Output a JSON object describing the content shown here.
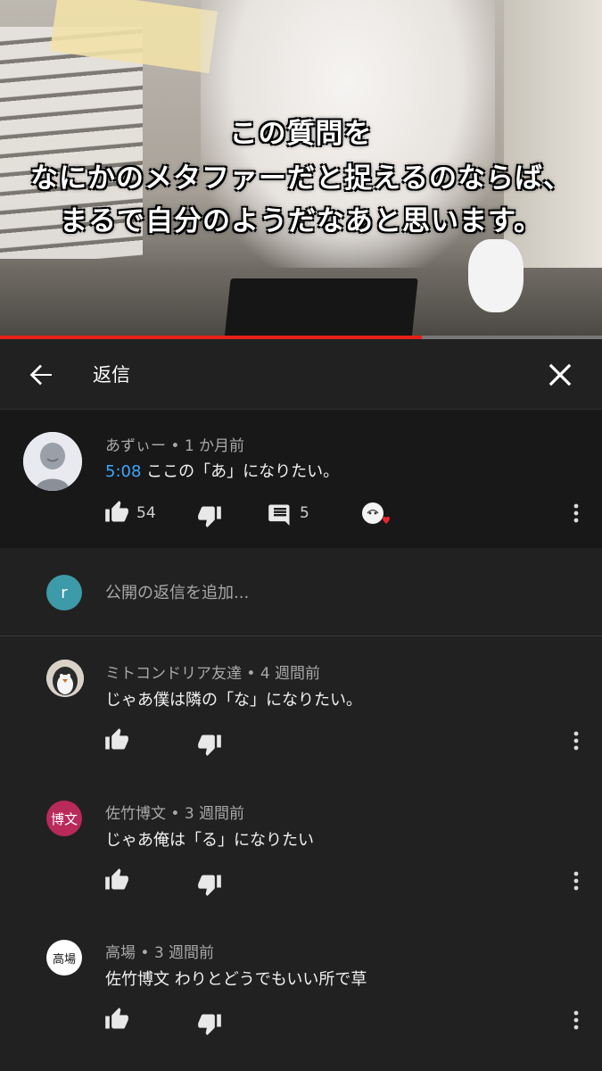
{
  "video": {
    "subtitle_lines": [
      "この質問を",
      "なにかのメタファーだと捉えるのならば、",
      "まるで自分のようだなあと思います。"
    ],
    "progress": 0.7
  },
  "header": {
    "title": "返信",
    "back_icon": "arrow-left-icon",
    "close_icon": "close-icon"
  },
  "parent_comment": {
    "author_meta": "あずぃー • 1 か月前",
    "timestamp": "5:08",
    "text": "ここの「あ」になりたい。",
    "likes": "54",
    "replies": "5"
  },
  "add_reply": {
    "avatar_letter": "r",
    "placeholder": "公開の返信を追加..."
  },
  "replies": [
    {
      "author_meta": "ミトコンドリア友達 • 4 週間前",
      "text": "じゃあ僕は隣の「な」になりたい。"
    },
    {
      "avatar_text": "博文",
      "author_meta": "佐竹博文 • 3 週間前",
      "text": "じゃあ俺は「る」になりたい"
    },
    {
      "avatar_text": "高場",
      "author_meta": "高場 • 3 週間前",
      "text": "佐竹博文 わりとどうでもいい所で草"
    }
  ],
  "colors": {
    "background": "#212121",
    "parent_background": "#181818",
    "timestamp_blue": "#3ea6ff",
    "progress_red": "#e62117",
    "reply_avatar_teal": "#3d9aa8",
    "hirobumi_avatar": "#b92a5b"
  }
}
